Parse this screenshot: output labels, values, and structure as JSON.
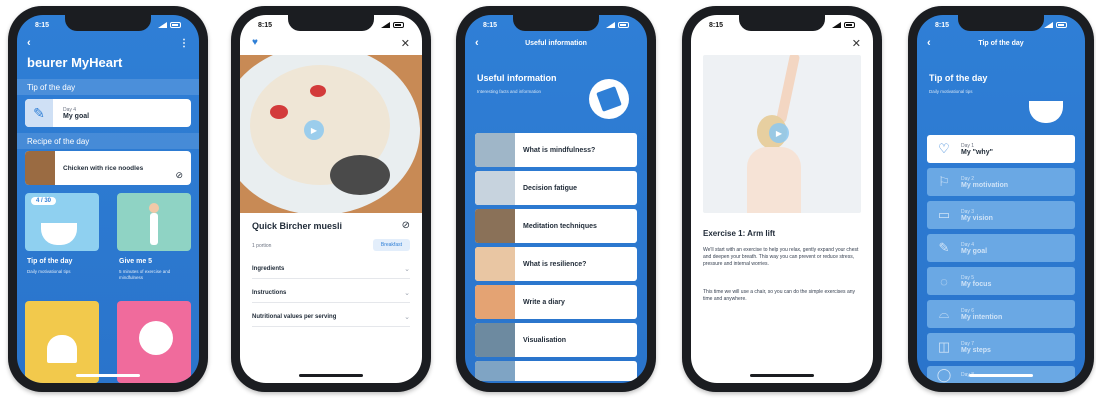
{
  "status_time": "8:15",
  "phone1": {
    "app_title": "beurer MyHeart",
    "tip_section": "Tip of the day",
    "tip_card": {
      "day": "Day 4",
      "title": "My goal"
    },
    "recipe_section": "Recipe of the day",
    "recipe_card": {
      "title": "Chicken with rice noodles"
    },
    "tile_tip": {
      "badge": "4 / 30",
      "label": "Tip of the day",
      "sub": "Daily motivational tips"
    },
    "tile_giveme5": {
      "label": "Give me 5",
      "sub": "5 minutes of exercise and mindfulness"
    }
  },
  "phone2": {
    "recipe_title": "Quick Bircher muesli",
    "portion": "1 portion",
    "tag": "Breakfast",
    "sections": [
      "Ingredients",
      "Instructions",
      "Nutritional values per serving"
    ]
  },
  "phone3": {
    "nav_title": "Useful information",
    "hero_title": "Useful information",
    "hero_sub": "Interesting facts and information",
    "items": [
      "What is mindfulness?",
      "Decision fatigue",
      "Meditation techniques",
      "What is resilience?",
      "Write a diary",
      "Visualisation"
    ]
  },
  "phone4": {
    "exercise_title": "Exercise 1: Arm lift",
    "paragraph1": "We'll start with an exercise to help you relax, gently expand your chest and deepen your breath. This way you can prevent or reduce stress, pressure and internal worries.",
    "paragraph2": "This time we will use a chair, so you can do the simple exercises any time and anywhere."
  },
  "phone5": {
    "nav_title": "Tip of the day",
    "hero_title": "Tip of the day",
    "hero_sub": "Daily motivational tips",
    "days": [
      {
        "day": "Day 1",
        "title": "My \"why\"",
        "icon": "heart-icon",
        "glyph": "♡"
      },
      {
        "day": "Day 2",
        "title": "My motivation",
        "icon": "signpost-icon",
        "glyph": "⚐"
      },
      {
        "day": "Day 3",
        "title": "My vision",
        "icon": "map-icon",
        "glyph": "▭"
      },
      {
        "day": "Day 4",
        "title": "My goal",
        "icon": "pencil-icon",
        "glyph": "✎"
      },
      {
        "day": "Day 5",
        "title": "My focus",
        "icon": "speech-icon",
        "glyph": "◌"
      },
      {
        "day": "Day 6",
        "title": "My intention",
        "icon": "cloche-icon",
        "glyph": "⌓"
      },
      {
        "day": "Day 7",
        "title": "My steps",
        "icon": "shoe-icon",
        "glyph": "◫"
      },
      {
        "day": "Day 8",
        "title": "",
        "icon": "circle-icon",
        "glyph": "◯"
      }
    ]
  },
  "colors": {
    "brand_blue": "#2f7fd6",
    "tile_light_blue": "#8fd0f0",
    "tile_green": "#8fd3c4",
    "tile_yellow": "#f2c94c",
    "tile_pink": "#f06b9c"
  }
}
